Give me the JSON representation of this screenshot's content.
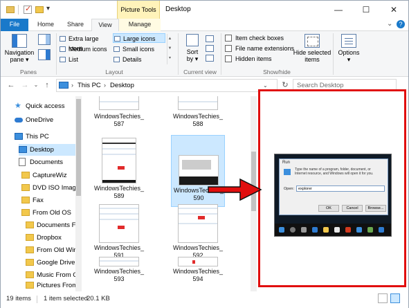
{
  "titlebar": {
    "context_tab": "Picture Tools",
    "window_title": "Desktop",
    "min": "—",
    "max": "☐",
    "close": "✕"
  },
  "tabs": {
    "file": "File",
    "home": "Home",
    "share": "Share",
    "view": "View",
    "manage": "Manage",
    "help": "?"
  },
  "ribbon": {
    "panes": {
      "navigation_pane": "Navigation pane ▾",
      "group": "Panes"
    },
    "layout": {
      "items": [
        "Extra large icons",
        "Large icons",
        "Medium icons",
        "Small icons",
        "List",
        "Details"
      ],
      "selected": "Large icons",
      "group": "Layout"
    },
    "current_view": {
      "sort_by": "Sort by ▾",
      "group": "Current view"
    },
    "show_hide": {
      "item_check_boxes": "Item check boxes",
      "file_name_extensions": "File name extensions",
      "hidden_items": "Hidden items",
      "hide_selected": "Hide selected items",
      "group": "Show/hide"
    },
    "options": "Options ▾"
  },
  "address": {
    "crumbs": [
      "This PC",
      "Desktop"
    ],
    "search_placeholder": "Search Desktop"
  },
  "nav": {
    "items": [
      {
        "label": "Quick access",
        "icon": "star-icon"
      },
      {
        "label": "OneDrive",
        "icon": "cloud-icon"
      },
      {
        "label": "This PC",
        "icon": "pc-icon"
      },
      {
        "label": "Desktop",
        "icon": "desktop-icon"
      },
      {
        "label": "Documents",
        "icon": "document-icon"
      },
      {
        "label": "CaptureWiz",
        "icon": "folder-icon"
      },
      {
        "label": "DVD ISO Image",
        "icon": "folder-icon"
      },
      {
        "label": "Fax",
        "icon": "folder-icon"
      },
      {
        "label": "From Old OS",
        "icon": "folder-icon"
      },
      {
        "label": "Documents F",
        "icon": "folder-icon"
      },
      {
        "label": "Dropbox",
        "icon": "folder-icon"
      },
      {
        "label": "From Old Wir",
        "icon": "folder-icon"
      },
      {
        "label": "Google Drive",
        "icon": "folder-icon"
      },
      {
        "label": "Music From C",
        "icon": "folder-icon"
      },
      {
        "label": "Pictures From",
        "icon": "folder-icon"
      }
    ]
  },
  "files": [
    {
      "line1": "WindowsTechies_",
      "line2": "587"
    },
    {
      "line1": "WindowsTechies_",
      "line2": "588"
    },
    {
      "line1": "WindowsTechies_",
      "line2": "589"
    },
    {
      "line1": "WindowsTechies_",
      "line2": "590"
    },
    {
      "line1": "WindowsTechies_",
      "line2": "591"
    },
    {
      "line1": "WindowsTechies_",
      "line2": "592"
    },
    {
      "line1": "WindowsTechies_",
      "line2": "593"
    },
    {
      "line1": "WindowsTechies_",
      "line2": "594"
    }
  ],
  "preview": {
    "run_title": "Run",
    "run_description": "Type the name of a program, folder, document, or Internet resource, and Windows will open it for you.",
    "open_label": "Open:",
    "open_value": "explorer",
    "ok": "OK",
    "cancel": "Cancel",
    "browse": "Browse..."
  },
  "status": {
    "items": "19 items",
    "selected": "1 item selected",
    "size": "20.1 KB"
  },
  "colors": {
    "accent": "#1979ca",
    "selection": "#cce8ff",
    "highlight_border": "#e10e0e",
    "context_tab": "#fff3ba"
  }
}
